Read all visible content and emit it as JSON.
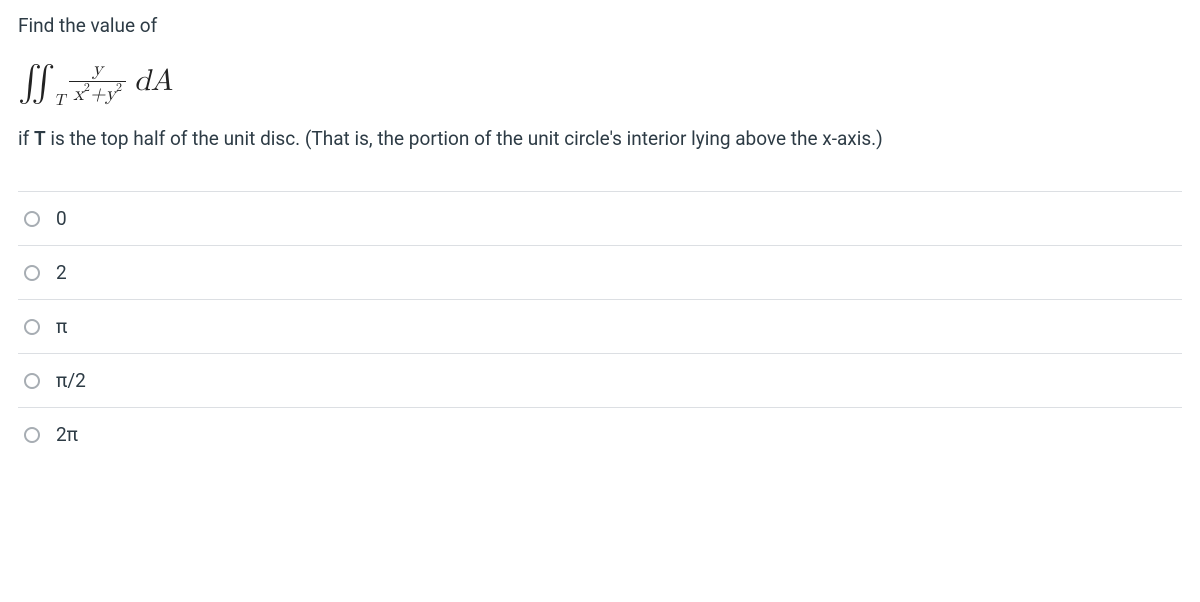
{
  "question": {
    "prompt_line1": "Find the value of",
    "math": {
      "integral_symbol": "∬",
      "subscript": "T",
      "numerator": "y",
      "denom_x": "x",
      "denom_plus": "+",
      "denom_y": "y",
      "squared": "2",
      "dA": "dA"
    },
    "prompt_line2_pre": "if ",
    "prompt_line2_bold": "T",
    "prompt_line2_post": " is the top half of the unit disc. (That is, the portion of the unit circle's interior lying above the x-axis.)"
  },
  "answers": {
    "options": [
      {
        "label": "0"
      },
      {
        "label": "2"
      },
      {
        "label": "π"
      },
      {
        "label": "π/2"
      },
      {
        "label": "2π"
      }
    ]
  }
}
